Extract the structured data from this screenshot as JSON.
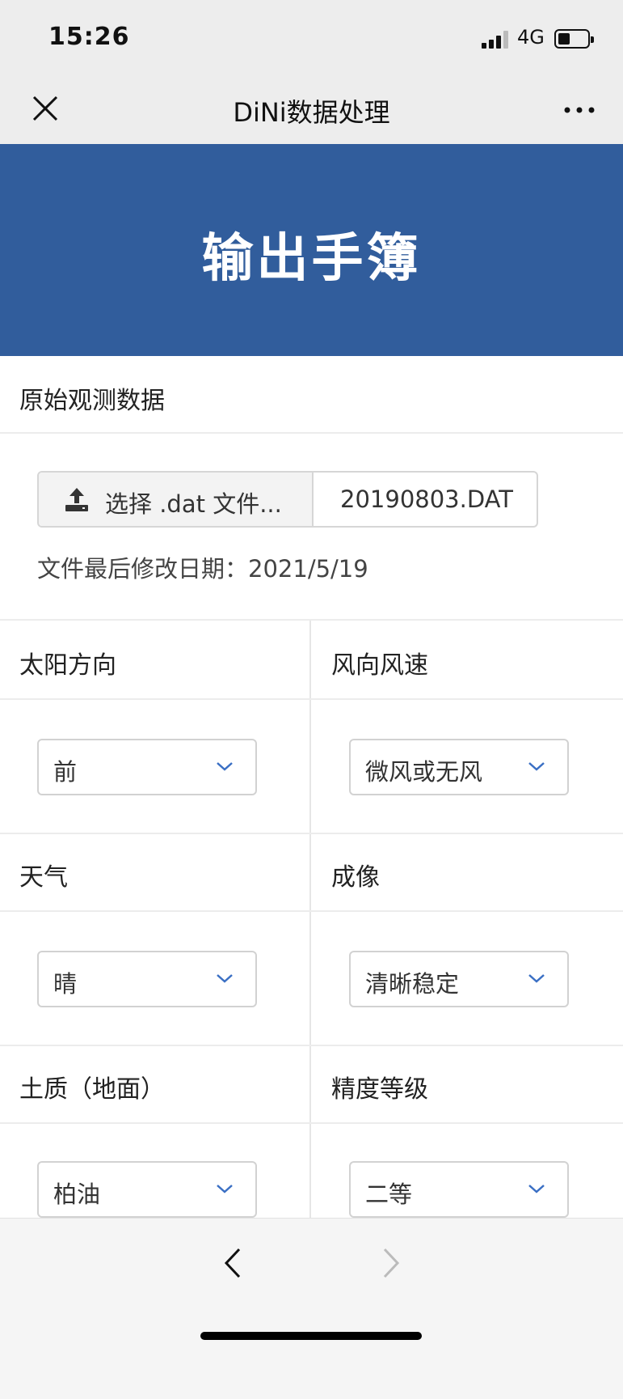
{
  "status": {
    "time": "15:26",
    "network": "4G"
  },
  "nav": {
    "title": "DiNi数据处理"
  },
  "hero": {
    "title": "输出手簿"
  },
  "raw_section": {
    "label": "原始观测数据"
  },
  "file": {
    "button_label": "选择 .dat 文件...",
    "selected_name": "20190803.DAT",
    "modified_label": "文件最后修改日期：",
    "modified_date": "2021/5/19"
  },
  "fields": {
    "sun_direction": {
      "label": "太阳方向",
      "value": "前"
    },
    "wind": {
      "label": "风向风速",
      "value": "微风或无风"
    },
    "weather": {
      "label": "天气",
      "value": "晴"
    },
    "imaging": {
      "label": "成像",
      "value": "清晰稳定"
    },
    "soil": {
      "label": "土质（地面）",
      "value": "柏油"
    },
    "accuracy": {
      "label": "精度等级",
      "value": "二等"
    }
  },
  "colors": {
    "hero_bg": "#315d9c",
    "chevron": "#3a6fc4"
  }
}
